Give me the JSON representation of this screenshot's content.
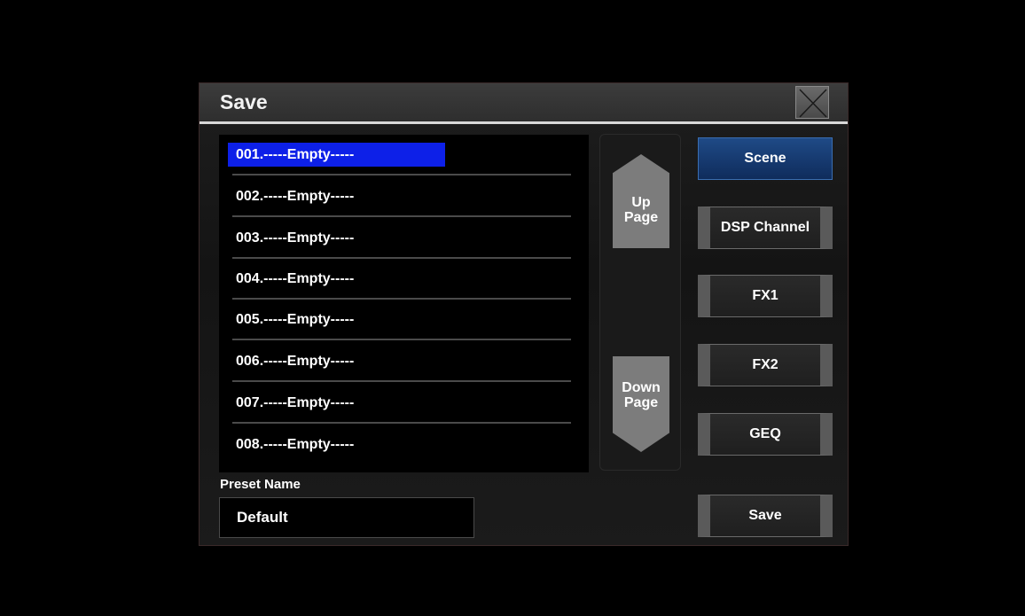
{
  "dialog": {
    "title": "Save",
    "close_icon": "close-icon"
  },
  "preset_list": {
    "selected_index": 0,
    "items": [
      "001.-----Empty-----",
      "002.-----Empty-----",
      "003.-----Empty-----",
      "004.-----Empty-----",
      "005.-----Empty-----",
      "006.-----Empty-----",
      "007.-----Empty-----",
      "008.-----Empty-----"
    ]
  },
  "pager": {
    "up_line1": "Up",
    "up_line2": "Page",
    "down_line1": "Down",
    "down_line2": "Page"
  },
  "categories": {
    "scene": "Scene",
    "dsp_channel": "DSP Channel",
    "fx1": "FX1",
    "fx2": "FX2",
    "geq": "GEQ"
  },
  "preset_name": {
    "label": "Preset Name",
    "value": "Default"
  },
  "actions": {
    "save": "Save"
  },
  "colors": {
    "selection": "#0d20e8",
    "active_button": "#1f4a86"
  }
}
